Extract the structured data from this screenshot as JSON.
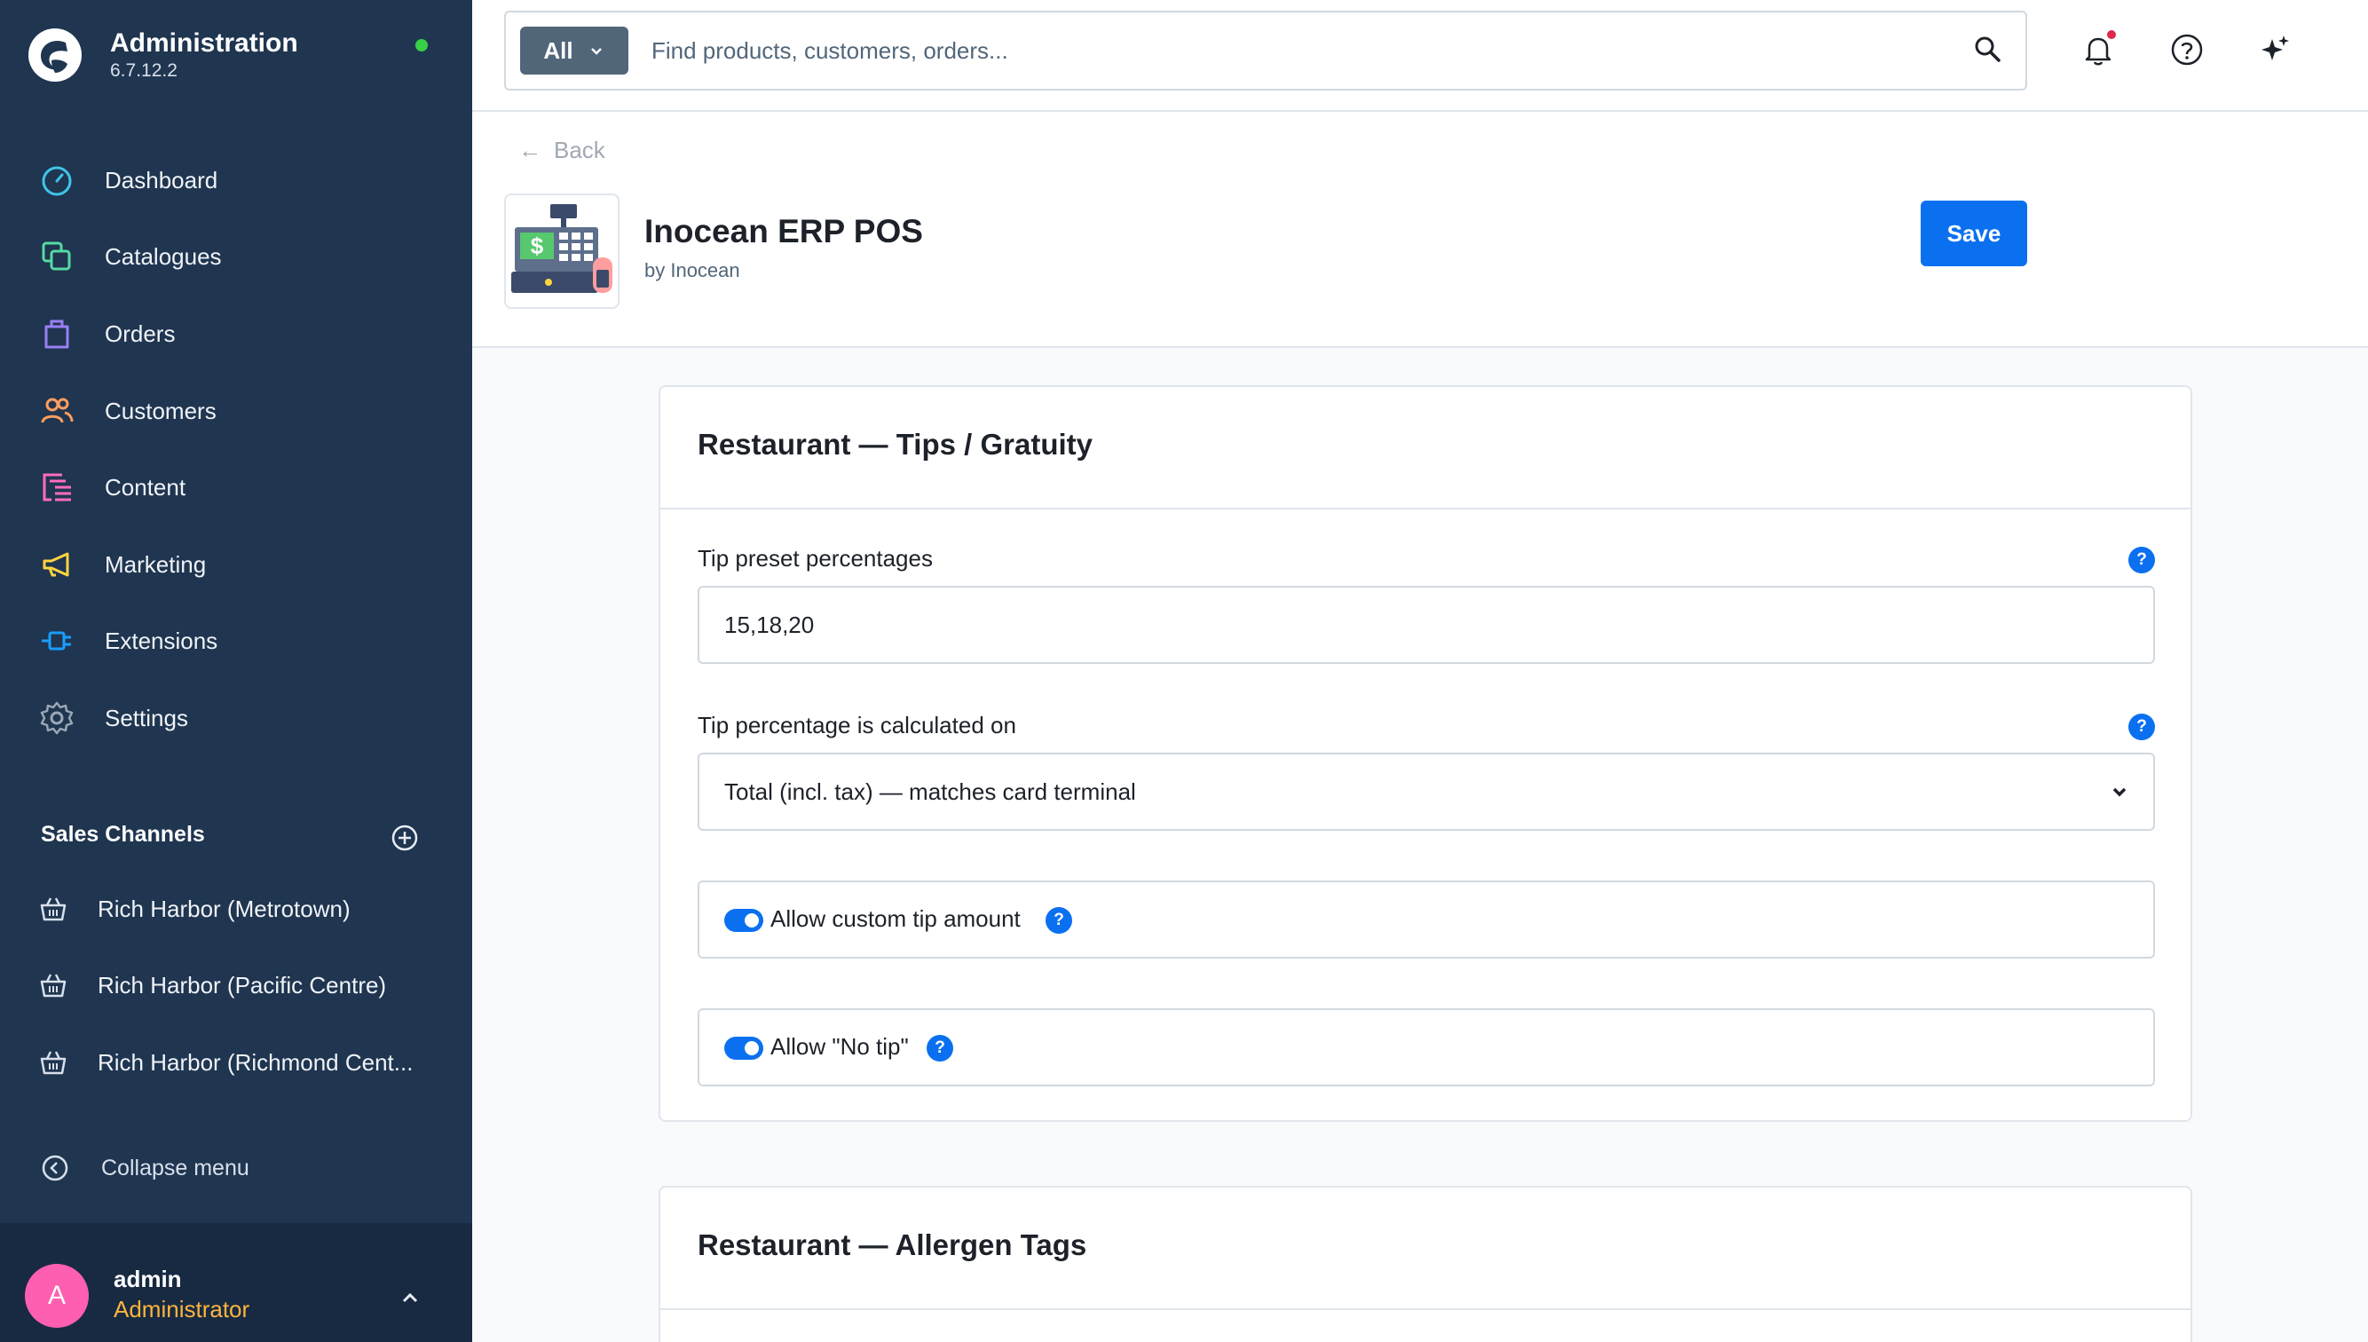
{
  "app": {
    "title": "Administration",
    "version": "6.7.12.2"
  },
  "nav": {
    "items": [
      {
        "label": "Dashboard",
        "icon": "dashboard-icon"
      },
      {
        "label": "Catalogues",
        "icon": "catalogues-icon"
      },
      {
        "label": "Orders",
        "icon": "orders-icon"
      },
      {
        "label": "Customers",
        "icon": "customers-icon"
      },
      {
        "label": "Content",
        "icon": "content-icon"
      },
      {
        "label": "Marketing",
        "icon": "marketing-icon"
      },
      {
        "label": "Extensions",
        "icon": "extensions-icon"
      },
      {
        "label": "Settings",
        "icon": "settings-icon"
      }
    ],
    "colors": {
      "dashboard": "#3fc5e9",
      "catalogues": "#57d9a3",
      "orders": "#9a7ff5",
      "customers": "#ff9e5e",
      "content": "#ff6dbb",
      "marketing": "#ffd440",
      "extensions": "#189eff",
      "settings": "#9aa8b5"
    }
  },
  "sales_channels": {
    "title": "Sales Channels",
    "items": [
      {
        "label": "Rich Harbor (Metrotown)"
      },
      {
        "label": "Rich Harbor (Pacific Centre)"
      },
      {
        "label": "Rich Harbor (Richmond Cent..."
      }
    ]
  },
  "collapse_label": "Collapse menu",
  "user": {
    "initial": "A",
    "name": "admin",
    "role": "Administrator"
  },
  "search": {
    "filter_label": "All",
    "placeholder": "Find products, customers, orders..."
  },
  "page": {
    "back_label": "Back",
    "app_title": "Inocean ERP POS",
    "app_author": "by Inocean",
    "save_label": "Save"
  },
  "tips_card": {
    "title": "Restaurant — Tips / Gratuity",
    "preset_label": "Tip preset percentages",
    "preset_value": "15,18,20",
    "calc_label": "Tip percentage is calculated on",
    "calc_value": "Total (incl. tax) — matches card terminal",
    "custom_tip_label": "Allow custom tip amount",
    "custom_tip_enabled": true,
    "no_tip_label": "Allow \"No tip\"",
    "no_tip_enabled": true
  },
  "allergen_card": {
    "title": "Restaurant — Allergen Tags"
  },
  "theme": {
    "sidebar_bg": "#1f3550",
    "accent": "#0b70f0",
    "status_online": "#37d046",
    "avatar_bg": "#ff5fb0",
    "role_color": "#ffb43d"
  }
}
